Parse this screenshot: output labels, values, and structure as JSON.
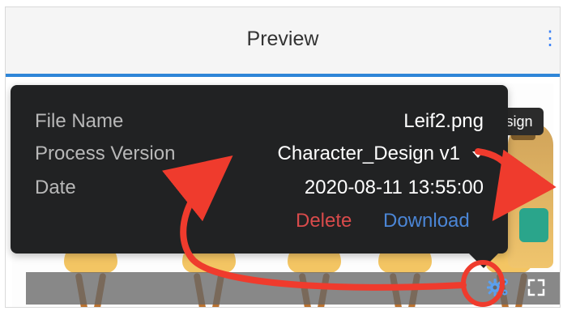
{
  "header": {
    "title": "Preview",
    "menu_label": "⋮"
  },
  "popup": {
    "rows": [
      {
        "label": "File Name",
        "value": "Leif2.png"
      },
      {
        "label": "Process Version",
        "value": "Character_Design v1"
      },
      {
        "label": "Date",
        "value": "2020-08-11 13:55:00"
      }
    ],
    "delete_label": "Delete",
    "download_label": "Download"
  },
  "image_overlay": {
    "tag_label": "sign"
  },
  "icons": {
    "settings": "gear-icon",
    "fullscreen": "fullscreen-icon",
    "dropdown": "chevron-down-icon"
  },
  "colors": {
    "header_bg": "#f5f5f5",
    "accent": "#2f86d8",
    "popup_bg": "#212223",
    "label": "#b8b8b8",
    "value": "#ffffff",
    "delete": "#d94b4b",
    "download": "#4b86d6",
    "annotation": "#ef3b2d",
    "bottom_bar": "#666666"
  }
}
